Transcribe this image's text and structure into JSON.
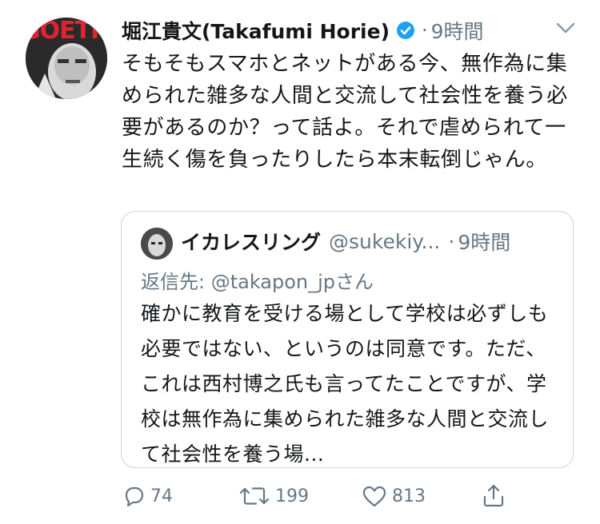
{
  "tweet": {
    "author_name": "堀江貴文(Takafumi Horie)",
    "separator": "·",
    "time": "9時間",
    "avatar_text": "GOETHE",
    "text": "そもそもスマホとネットがある今、無作為に集められた雑多な人間と交流して社会性を養う必要があるのか？って話よ。それで虐められて一生続く傷を負ったりしたら本末転倒じゃん。"
  },
  "quoted": {
    "author_name": "イカレスリング",
    "handle": "@sukekiy...",
    "separator": "·",
    "time": "9時間",
    "reply_to": "返信先: @takapon_jpさん",
    "text": "確かに教育を受ける場として学校は必ずしも必要ではない、というのは同意です。ただ、これは西村博之氏も言ってたことですが、学校は無作為に集められた雑多な人間と交流して社会性を養う場..."
  },
  "actions": {
    "reply_count": "74",
    "retweet_count": "199",
    "like_count": "813"
  },
  "colors": {
    "verified": "#1da1f2",
    "secondary": "#657786",
    "border": "#ccd6dd"
  },
  "icons": [
    "verified-badge-icon",
    "chevron-down-icon",
    "reply-icon",
    "retweet-icon",
    "like-icon",
    "share-icon"
  ]
}
